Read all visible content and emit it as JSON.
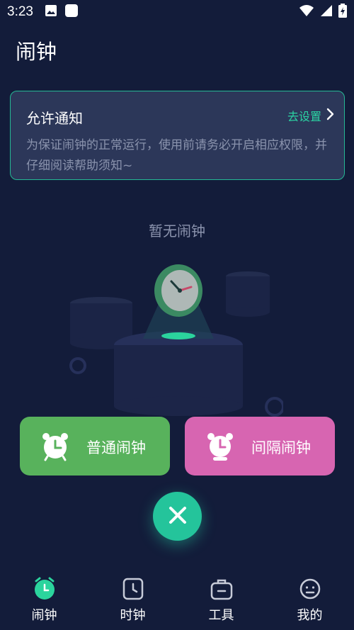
{
  "status_bar": {
    "time": "3:23",
    "left_icons": [
      "image-icon",
      "square-app-icon"
    ],
    "right_icons": [
      "wifi-icon",
      "signal-icon",
      "battery-charging-icon"
    ]
  },
  "header": {
    "title": "闹钟"
  },
  "notice": {
    "title": "允许通知",
    "action_label": "去设置",
    "description": "为保证闹钟的正常运行，使用前请务必开启相应权限，并仔细阅读帮助须知~"
  },
  "empty_state": {
    "text": "暂无闹钟"
  },
  "actions": {
    "normal_label": "普通闹钟",
    "interval_label": "间隔闹钟"
  },
  "bottom_nav": {
    "items": [
      {
        "label": "闹钟",
        "icon": "alarm-icon",
        "active": true
      },
      {
        "label": "时钟",
        "icon": "clock-icon",
        "active": false
      },
      {
        "label": "工具",
        "icon": "toolbox-icon",
        "active": false
      },
      {
        "label": "我的",
        "icon": "profile-icon",
        "active": false
      }
    ]
  },
  "colors": {
    "background": "#131c3a",
    "accent": "#24c49b",
    "normal_button": "#58b25c",
    "interval_button": "#d765b1"
  }
}
